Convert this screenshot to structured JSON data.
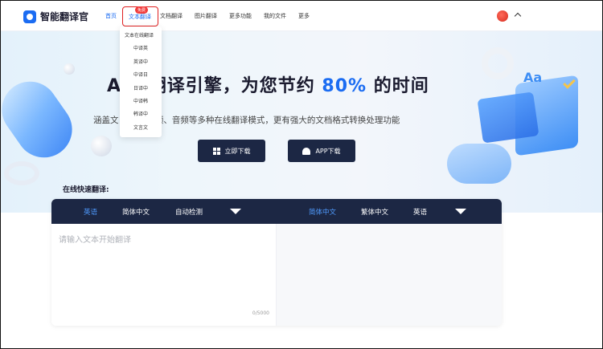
{
  "app": {
    "name": "智能翻译官"
  },
  "nav": {
    "items": [
      {
        "label": "首页"
      },
      {
        "label": "文本翻译",
        "badge": "免费"
      },
      {
        "label": "文档翻译"
      },
      {
        "label": "图片翻译"
      },
      {
        "label": "更多功能"
      },
      {
        "label": "我的文件"
      },
      {
        "label": "更多"
      }
    ]
  },
  "dropdown": {
    "items": [
      "文本在线翻译",
      "中译英",
      "英译中",
      "中译日",
      "日译中",
      "中译韩",
      "韩译中",
      "文言文"
    ]
  },
  "hero": {
    "title_prefix": "A",
    "title_main": "能翻译引擎，为您节约",
    "title_highlight": "80%",
    "title_suffix": "的时间",
    "subtitle": "涵盖文      图片、视频、音频等多种在线翻译模式，更有强大的文档格式转换处理功能",
    "download_label": "立即下载",
    "app_label": "APP下载"
  },
  "deco": {
    "aa": "Aa"
  },
  "quick": {
    "label": "在线快速翻译:",
    "source_langs": [
      "英语",
      "简体中文",
      "自动检测"
    ],
    "target_langs": [
      "简体中文",
      "繁体中文",
      "英语"
    ],
    "placeholder": "请输入文本开始翻译",
    "counter": "0/5000"
  },
  "colors": {
    "accent": "#1b6cf2",
    "dark_bar": "#1c2744",
    "badge_red": "#f23c3c"
  }
}
